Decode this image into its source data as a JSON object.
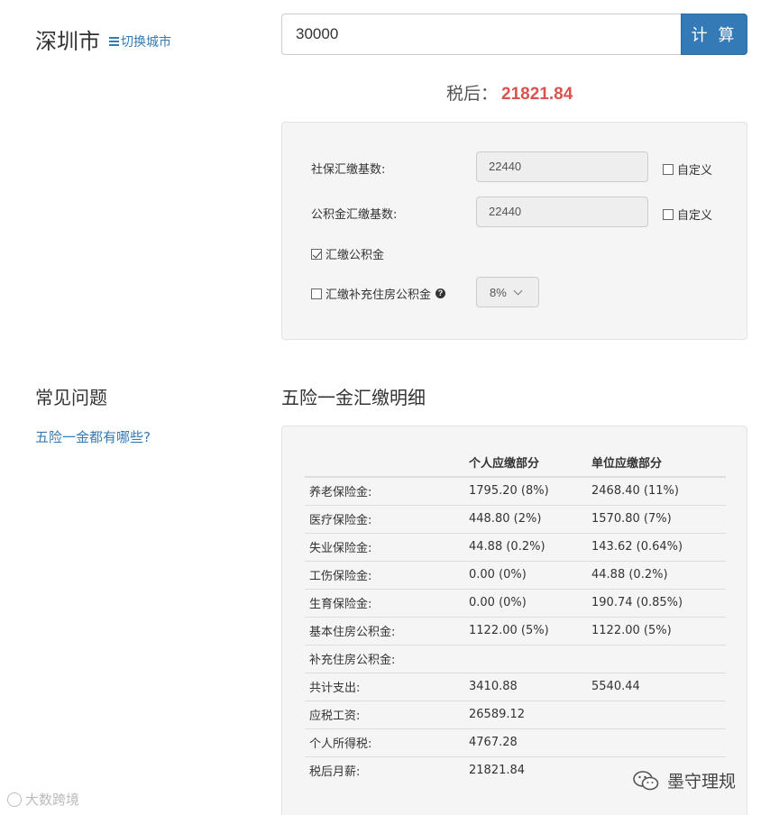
{
  "header": {
    "city": "深圳市",
    "switch_city": "切换城市"
  },
  "calculator": {
    "salary_value": "30000",
    "calc_button": "计 算"
  },
  "result": {
    "after_tax_label": "税后：",
    "after_tax_value": "21821.84"
  },
  "settings": {
    "social_base_label": "社保汇缴基数:",
    "social_base_value": "22440",
    "housing_base_label": "公积金汇缴基数:",
    "housing_base_value": "22440",
    "custom_label": "自定义",
    "pay_housing_fund_label": "汇缴公积金",
    "pay_housing_fund_checked": true,
    "pay_supp_fund_label": "汇缴补充住房公积金",
    "pay_supp_fund_checked": false,
    "supp_rate": "8%"
  },
  "faq": {
    "title": "常见问题",
    "link": "五险一金都有哪些?"
  },
  "detail": {
    "title": "五险一金汇缴明细",
    "headers": [
      "",
      "个人应缴部分",
      "单位应缴部分"
    ],
    "rows": [
      [
        "养老保险金:",
        "1795.20 (8%)",
        "2468.40 (11%)"
      ],
      [
        "医疗保险金:",
        "448.80 (2%)",
        "1570.80 (7%)"
      ],
      [
        "失业保险金:",
        "44.88 (0.2%)",
        "143.62 (0.64%)"
      ],
      [
        "工伤保险金:",
        "0.00 (0%)",
        "44.88 (0.2%)"
      ],
      [
        "生育保险金:",
        "0.00 (0%)",
        "190.74 (0.85%)"
      ],
      [
        "基本住房公积金:",
        "1122.00 (5%)",
        "1122.00 (5%)"
      ],
      [
        "补充住房公积金:",
        "",
        ""
      ],
      [
        "共计支出:",
        "3410.88",
        "5540.44"
      ],
      [
        "应税工资:",
        "26589.12",
        ""
      ],
      [
        "个人所得税:",
        "4767.28",
        ""
      ],
      [
        "税后月薪:",
        "21821.84",
        ""
      ]
    ]
  },
  "watermarks": {
    "left": "大数跨境",
    "right": "墨守理规"
  }
}
